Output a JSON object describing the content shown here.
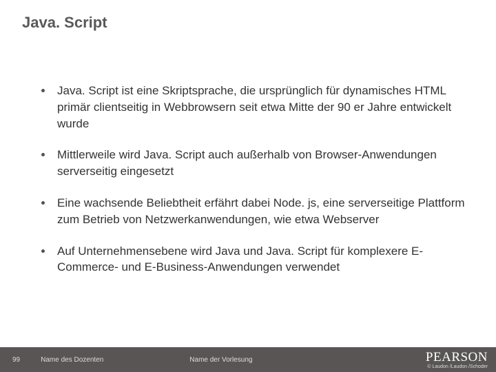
{
  "title": "Java. Script",
  "bullets": [
    "Java. Script ist eine Skriptsprache, die ursprünglich für dynamisches HTML primär clientseitig in Webbrowsern seit etwa Mitte der 90 er Jahre entwickelt wurde",
    "Mittlerweile wird Java. Script auch außerhalb von Browser-Anwendungen serverseitig eingesetzt",
    "Eine wachsende Beliebtheit erfährt dabei Node. js, eine serverseitige Plattform zum Betrieb von Netzwerkanwendungen, wie etwa Webserver",
    "Auf Unternehmensebene wird Java und Java. Script für komplexere E-Commerce- und E-Business-Anwendungen verwendet"
  ],
  "footer": {
    "page_number": "99",
    "dozent_label": "Name des Dozenten",
    "vorlesung_label": "Name der Vorlesung",
    "brand": "PEARSON",
    "copyright": "© Laudon /Laudon /Schoder"
  }
}
